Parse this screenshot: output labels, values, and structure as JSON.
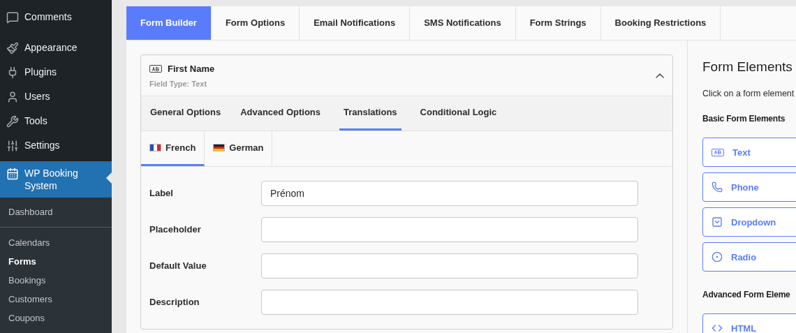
{
  "sidebar": {
    "items": [
      {
        "label": "Comments",
        "selected": false
      },
      {
        "label": "Appearance",
        "selected": false
      },
      {
        "label": "Plugins",
        "selected": false
      },
      {
        "label": "Users",
        "selected": false
      },
      {
        "label": "Tools",
        "selected": false
      },
      {
        "label": "Settings",
        "selected": false
      },
      {
        "label": "WP Booking System",
        "selected": true
      }
    ],
    "submenu": [
      {
        "label": "Dashboard",
        "selected": false
      },
      {
        "label": "Calendars",
        "selected": false
      },
      {
        "label": "Forms",
        "selected": true
      },
      {
        "label": "Bookings",
        "selected": false
      },
      {
        "label": "Customers",
        "selected": false
      },
      {
        "label": "Coupons",
        "selected": false
      }
    ]
  },
  "tabs": [
    {
      "label": "Form Builder",
      "selected": true
    },
    {
      "label": "Form Options",
      "selected": false
    },
    {
      "label": "Email Notifications",
      "selected": false
    },
    {
      "label": "SMS Notifications",
      "selected": false
    },
    {
      "label": "Form Strings",
      "selected": false
    },
    {
      "label": "Booking Restrictions",
      "selected": false
    }
  ],
  "field_card": {
    "title": "First Name",
    "subtitle": "Field Type: Text",
    "expanded": true,
    "option_tabs": [
      {
        "label": "General Options",
        "selected": false
      },
      {
        "label": "Advanced Options",
        "selected": false
      },
      {
        "label": "Translations",
        "selected": true
      },
      {
        "label": "Conditional Logic",
        "selected": false
      }
    ],
    "language_tabs": [
      {
        "label": "French",
        "selected": true
      },
      {
        "label": "German",
        "selected": false
      }
    ],
    "fields": [
      {
        "label": "Label",
        "value": "Prénom"
      },
      {
        "label": "Placeholder"
      },
      {
        "label": "Default Value"
      },
      {
        "label": "Description"
      }
    ]
  },
  "form_elements": {
    "title": "Form Elements",
    "hint": "Click on a form element",
    "sections": [
      {
        "title": "Basic Form Elements",
        "items": [
          {
            "label": "Text"
          },
          {
            "label": "Phone"
          },
          {
            "label": "Dropdown"
          },
          {
            "label": "Radio"
          }
        ]
      },
      {
        "title": "Advanced Form Eleme",
        "items": [
          {
            "label": "HTML"
          }
        ]
      }
    ]
  }
}
